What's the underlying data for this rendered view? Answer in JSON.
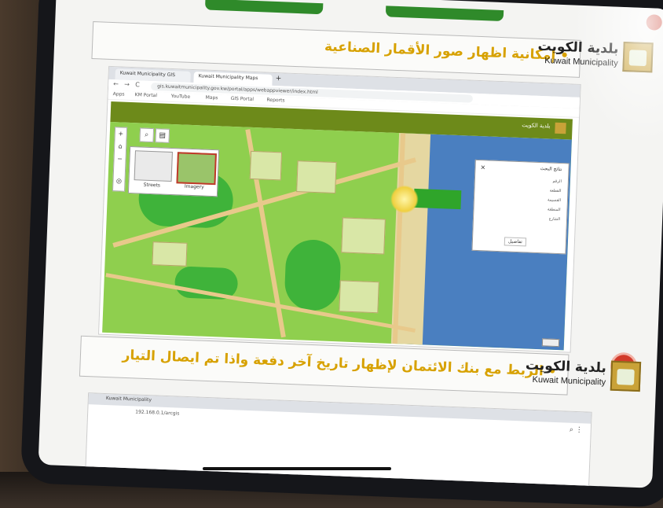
{
  "slide": {
    "top_row_text": "إمكانية اظهار صور الأقمار الصناعية",
    "bottom_row_text": "الربط مع بنك الائتمان لإظهار تاريخ آخر دفعة واذا تم ايصال التيار",
    "bullet": "•"
  },
  "brand": {
    "arabic": "بلدية الكويت",
    "english": "Kuwait Municipality"
  },
  "browser": {
    "tab1_title": "Kuwait Municipality GIS",
    "tab2_title": "Kuwait Municipality Maps",
    "add_tab": "+",
    "url": "gis.kuwaitmunicipality.gov.kw/portal/apps/webappviewer/index.html",
    "nav": {
      "back": "←",
      "forward": "→",
      "reload": "C"
    },
    "bookmarks": [
      "Apps",
      "KM Portal",
      "YouTube",
      "Maps",
      "GIS Portal",
      "Reports"
    ]
  },
  "map": {
    "header_title": "بلدية الكويت",
    "toolbar": {
      "zoom_in": "+",
      "zoom_out": "−",
      "home": "⌂",
      "locate": "◎"
    },
    "basemaps": [
      {
        "label": "Streets"
      },
      {
        "label": "Imagery"
      }
    ],
    "info": {
      "title": "نتائج البحث",
      "close": "×",
      "rows": [
        "الرقم",
        "القطعة",
        "القسيمة",
        "المنطقة",
        "الشارع"
      ],
      "button": "تفاصيل"
    }
  },
  "browser2": {
    "tab_title": "Kuwait Municipality",
    "url": "192.168.0.1/arcgis",
    "controls": "⌕ ⋮"
  },
  "colors": {
    "accent_gold": "#d7a100",
    "map_header": "#6d8a1a",
    "record_red": "#d23a2a"
  }
}
